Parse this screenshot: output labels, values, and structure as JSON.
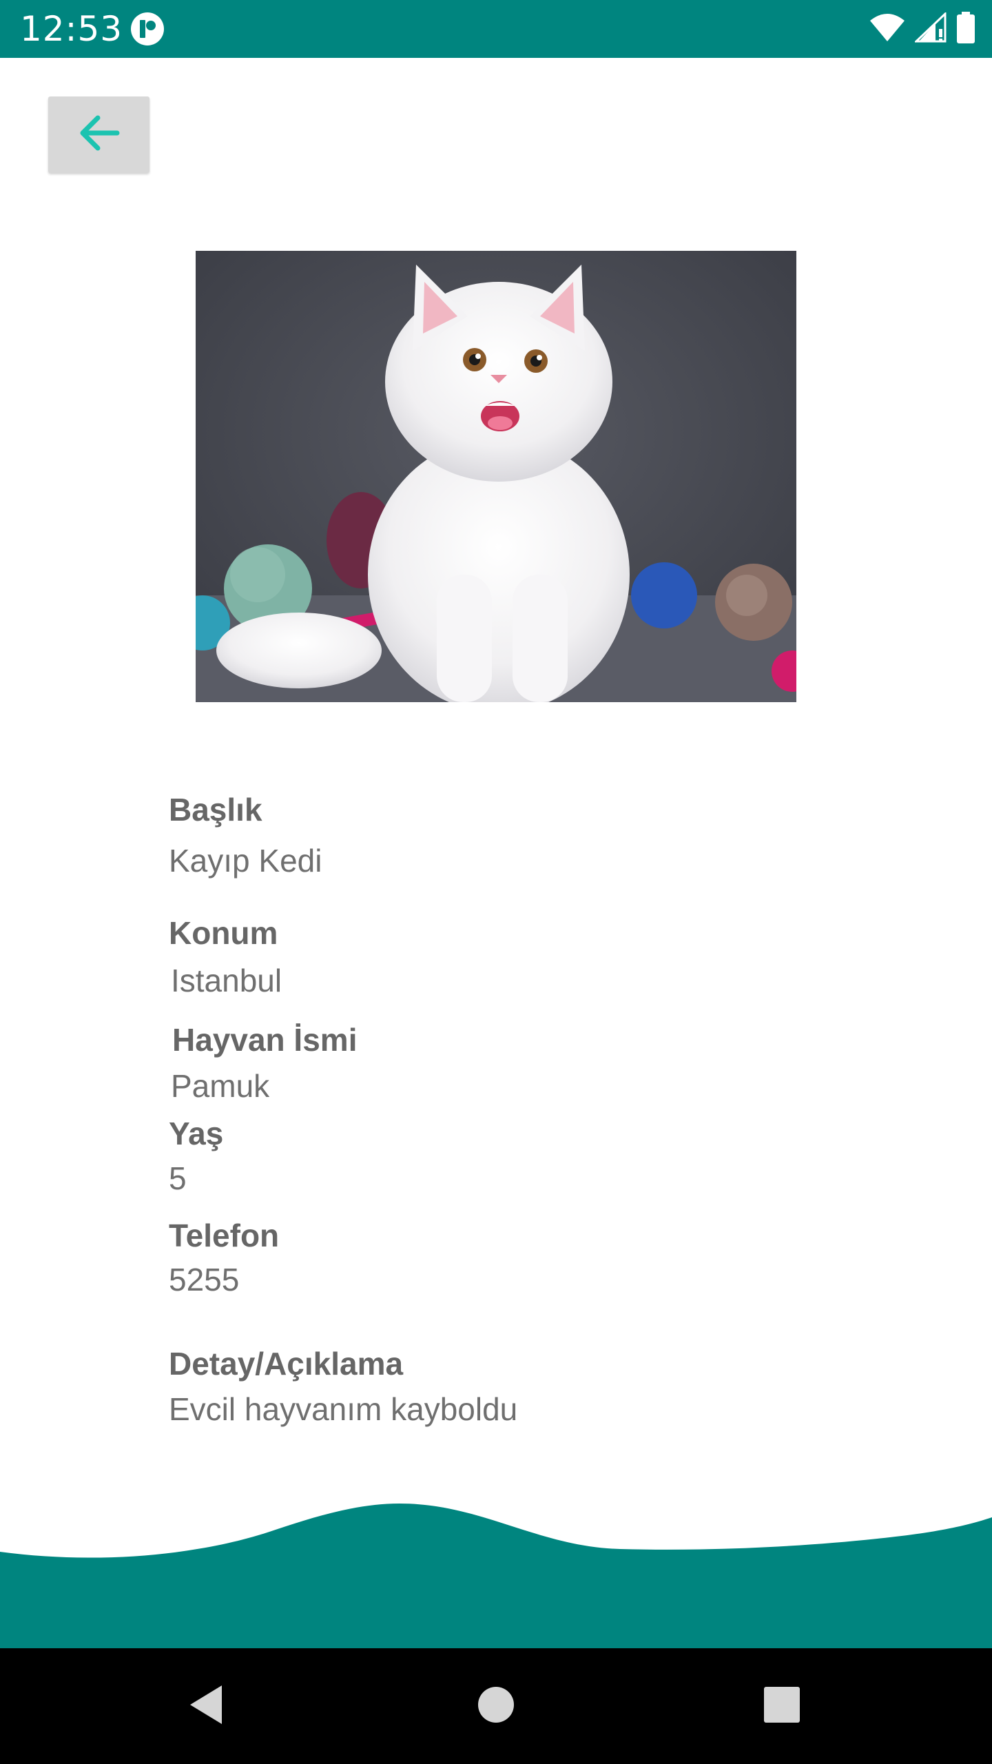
{
  "status_bar": {
    "time": "12:53",
    "background_color": "#00857f",
    "icons": [
      "app-notification-icon",
      "wifi-icon",
      "cellular-signal-icon",
      "battery-icon"
    ]
  },
  "toolbar": {
    "back_icon": "arrow-left-icon",
    "accent_color": "#1cc3b0"
  },
  "pet_photo": {
    "subject": "white-kitten",
    "background_color": "#4a4c55"
  },
  "details": {
    "title_label": "Başlık",
    "title_value": "Kayıp Kedi",
    "location_label": "Konum",
    "location_value": "Istanbul",
    "pet_name_label": "Hayvan İsmi",
    "pet_name_value": "Pamuk",
    "age_label": "Yaş",
    "age_value": "5",
    "phone_label": "Telefon",
    "phone_value": "5255",
    "description_label": "Detay/Açıklama",
    "description_value": "Evcil hayvanım kayboldu"
  },
  "footer": {
    "wave_color": "#00857f"
  },
  "nav_bar": {
    "icons": [
      "back-triangle-icon",
      "home-circle-icon",
      "recents-square-icon"
    ],
    "icon_color": "#d6d6d6"
  }
}
